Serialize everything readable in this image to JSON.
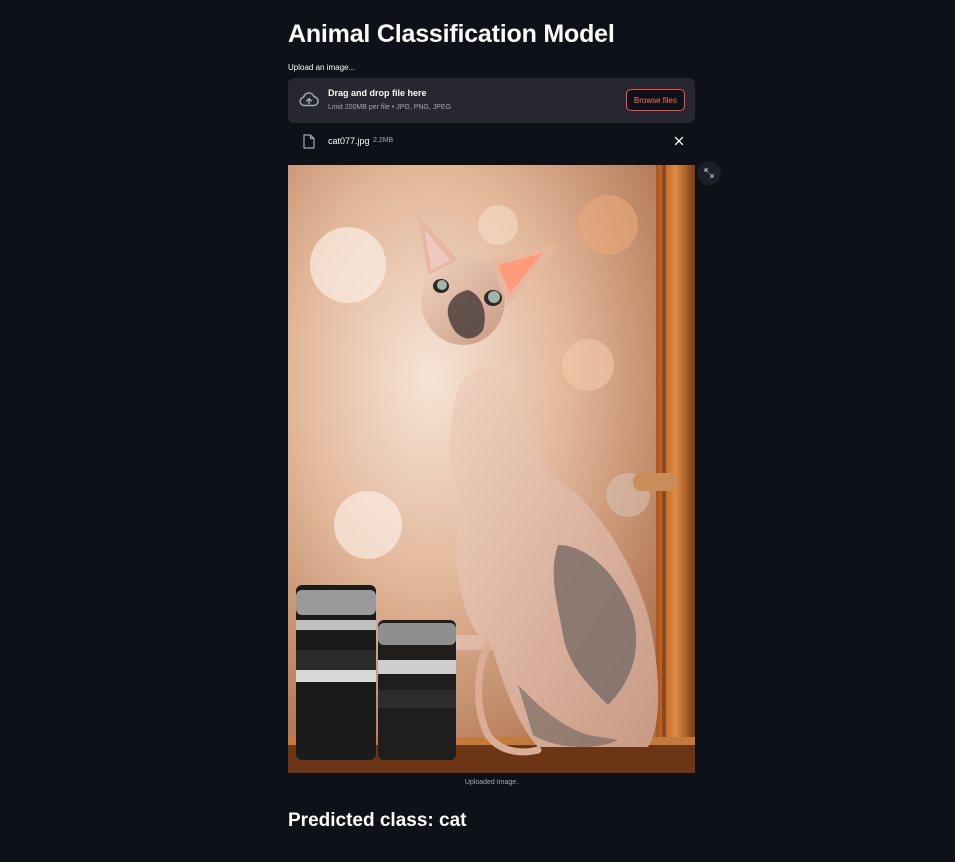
{
  "page": {
    "title": "Animal Classification Model"
  },
  "uploader": {
    "label": "Upload an image...",
    "drop_title": "Drag and drop file here",
    "limit_text": "Limit 200MB per file • JPG, PNG, JPEG",
    "browse_label": "Browse files"
  },
  "file": {
    "name": "cat077.jpg",
    "size": "2.2MB"
  },
  "image": {
    "caption": "Uploaded Image."
  },
  "result": {
    "text": "Predicted class: cat"
  },
  "icons": {
    "upload": "cloud-upload-icon",
    "file": "file-icon",
    "close": "close-icon",
    "expand": "fullscreen-icon"
  },
  "colors": {
    "background": "#0e1117",
    "dropzone": "#262730",
    "accent": "#ff4b4b"
  }
}
